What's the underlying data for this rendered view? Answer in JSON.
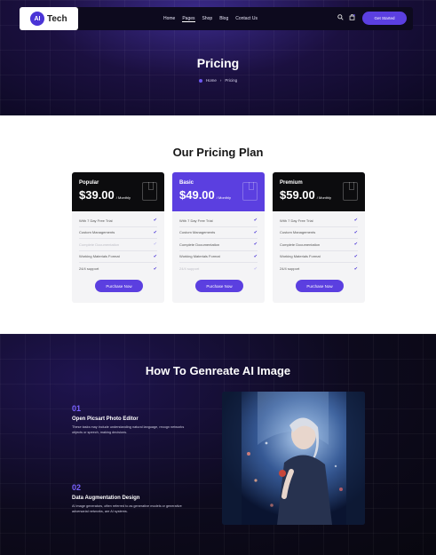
{
  "header": {
    "logo_text": "Tech",
    "logo_mark": "AI",
    "nav": [
      "Home",
      "Pages",
      "Shop",
      "Blog",
      "Contact Us"
    ],
    "cta_label": "Get Started",
    "hero_title": "Pricing",
    "breadcrumb": [
      "Home",
      "Pricing"
    ]
  },
  "pricing": {
    "title": "Our Pricing Plan",
    "plans": [
      {
        "name": "Popular",
        "price": "$39.00",
        "period": "/ Monthly",
        "features": [
          {
            "label": "With 7 Day Free Trial",
            "included": true
          },
          {
            "label": "Custom Managements",
            "included": true
          },
          {
            "label": "Complete Documentation",
            "included": false
          },
          {
            "label": "Working Materials Format",
            "included": true
          },
          {
            "label": "24/4 support",
            "included": true
          }
        ],
        "button": "Purchase Now"
      },
      {
        "name": "Basic",
        "price": "$49.00",
        "period": "/ Monthly",
        "features": [
          {
            "label": "With 7 Day Free Trial",
            "included": true
          },
          {
            "label": "Custom Managements",
            "included": true
          },
          {
            "label": "Complete Documentation",
            "included": true
          },
          {
            "label": "Working Materials Format",
            "included": true
          },
          {
            "label": "24/4 support",
            "included": false
          }
        ],
        "button": "Purchase Now"
      },
      {
        "name": "Premium",
        "price": "$59.00",
        "period": "/ Monthly",
        "features": [
          {
            "label": "With 7 Day Free Trial",
            "included": true
          },
          {
            "label": "Custom Managements",
            "included": true
          },
          {
            "label": "Complete Documentation",
            "included": true
          },
          {
            "label": "Working Materials Format",
            "included": true
          },
          {
            "label": "24/4 support",
            "included": true
          }
        ],
        "button": "Purchase Now"
      }
    ]
  },
  "ai_section": {
    "title": "How To Genreate AI Image",
    "steps": [
      {
        "number": "01",
        "title": "Open Picsart Photo Editor",
        "desc": "These tasks may include understanding natural language, recogn networks objects or speech, making decisions."
      },
      {
        "number": "02",
        "title": "Data Augmentation Design",
        "desc": "AI image generators, often referred to as generative models or generative adversarial networks, are AI systems."
      }
    ]
  },
  "icons": {
    "search": "search-icon",
    "cart": "cart-icon",
    "check": "check-icon",
    "plan_badge": "bookmark-icon"
  },
  "colors": {
    "accent": "#5b3fe0",
    "dark": "#0c0c0e",
    "hero_bg": "#1b1040"
  }
}
